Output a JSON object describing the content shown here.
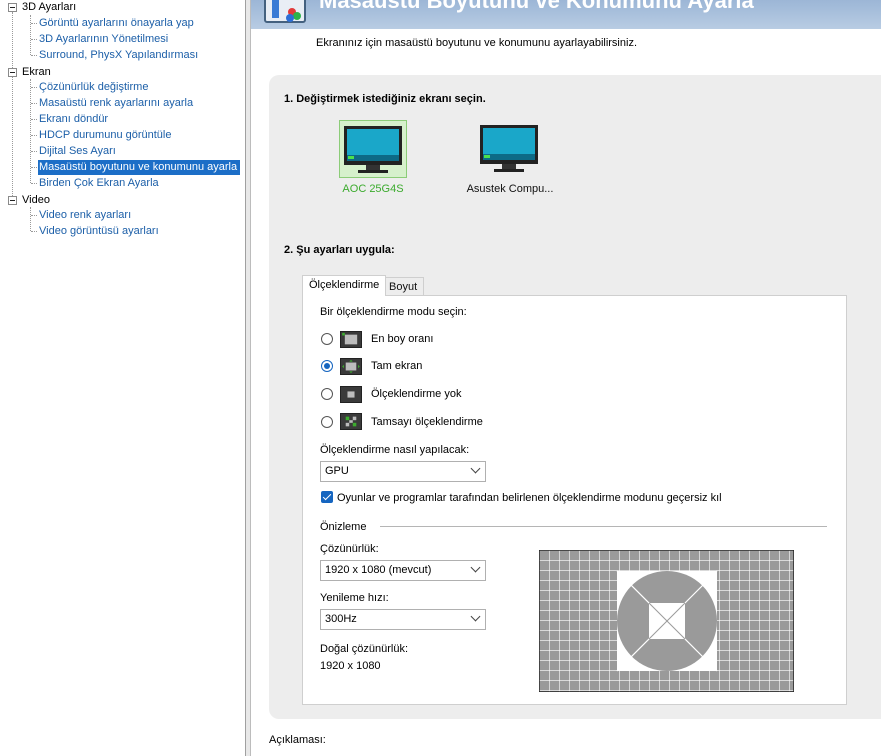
{
  "tree": {
    "categories": [
      {
        "label": "3D Ayarları",
        "items": [
          "Görüntü ayarlarını önayarla yap",
          "3D Ayarlarının Yönetilmesi",
          "Surround, PhysX Yapılandırması"
        ]
      },
      {
        "label": "Ekran",
        "items": [
          "Çözünürlük değiştirme",
          "Masaüstü renk ayarlarını ayarla",
          "Ekranı döndür",
          "HDCP durumunu görüntüle",
          "Dijital Ses Ayarı",
          "Masaüstü boyutunu ve konumunu ayarla",
          "Birden Çok Ekran Ayarla"
        ]
      },
      {
        "label": "Video",
        "items": [
          "Video renk ayarları",
          "Video görüntüsü ayarları"
        ]
      }
    ],
    "selected": "Masaüstü boyutunu ve konumunu ayarla"
  },
  "header": {
    "title": "Masaüstü Boyutunu ve Konumunu Ayarla"
  },
  "description": "Ekranınız için masaüstü boyutunu ve konumunu ayarlayabilirsiniz.",
  "step1": {
    "title": "1. Değiştirmek istediğiniz ekranı seçin.",
    "monitors": [
      {
        "label": "AOC 25G4S",
        "selected": true
      },
      {
        "label": "Asustek Compu...",
        "selected": false
      }
    ]
  },
  "step2": {
    "title": "2. Şu ayarları uygula:",
    "tabs": [
      "Ölçeklendirme",
      "Boyut"
    ],
    "active_tab": "Ölçeklendirme",
    "mode_prompt": "Bir ölçeklendirme modu seçin:",
    "modes": [
      {
        "label": "En boy oranı",
        "selected": false
      },
      {
        "label": "Tam ekran",
        "selected": true
      },
      {
        "label": "Ölçeklendirme yok",
        "selected": false
      },
      {
        "label": "Tamsayı ölçeklendirme",
        "selected": false
      }
    ],
    "how_label": "Ölçeklendirme nasıl yapılacak:",
    "how_value": "GPU",
    "override_label": "Oyunlar ve programlar tarafından belirlenen ölçeklendirme modunu geçersiz kıl",
    "override_checked": true,
    "preview_label": "Önizleme",
    "resolution_label": "Çözünürlük:",
    "resolution_value": "1920 x 1080 (mevcut)",
    "refresh_label": "Yenileme hızı:",
    "refresh_value": "300Hz",
    "native_label": "Doğal çözünürlük:",
    "native_value": "1920 x 1080"
  },
  "footer": {
    "description_label": "Açıklaması:"
  },
  "colors": {
    "selection": "#1c6ec7",
    "link": "#1c5fa8",
    "accent_green": "#3cab2e",
    "radio_blue": "#1565c0"
  }
}
